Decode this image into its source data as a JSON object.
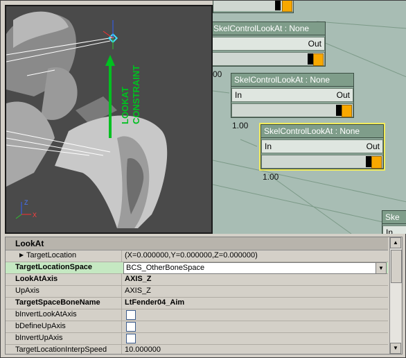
{
  "viewport": {
    "label_line1": "LOOKAT",
    "label_line2": "CONSTRAINT",
    "axis_z": "Z",
    "axis_x": "X"
  },
  "graph": {
    "node1": {
      "title": "SkelControlLookAt : None",
      "in": "",
      "out": "Out",
      "value": "00"
    },
    "node2": {
      "title": "SkelControlLookAt : None",
      "in": "In",
      "out": "Out",
      "value": "1.00"
    },
    "node3": {
      "title": "SkelControlLookAt : None",
      "in": "In",
      "out": "Out",
      "value": "1.00"
    },
    "node4": {
      "title": "Ske",
      "in": "In"
    }
  },
  "properties": {
    "header": "LookAt",
    "rows": [
      {
        "name": "TargetLocation",
        "value": "(X=0.000000,Y=0.000000,Z=0.000000)"
      },
      {
        "name": "TargetLocationSpace",
        "value": "BCS_OtherBoneSpace"
      },
      {
        "name": "LookAtAxis",
        "value": "AXIS_Z"
      },
      {
        "name": "UpAxis",
        "value": "AXIS_Z"
      },
      {
        "name": "TargetSpaceBoneName",
        "value": "LtFender04_Aim"
      },
      {
        "name": "bInvertLookAtAxis",
        "value": ""
      },
      {
        "name": "bDefineUpAxis",
        "value": ""
      },
      {
        "name": "bInvertUpAxis",
        "value": ""
      },
      {
        "name": "TargetLocationInterpSpeed",
        "value": "10.000000"
      }
    ]
  },
  "colors": {
    "graph_bg": "#a8bdb4",
    "node_title": "#7f9d8a",
    "selected_outline": "#f2ec5c",
    "orange_handle": "#f8a800",
    "lookat_green": "#00c020"
  }
}
